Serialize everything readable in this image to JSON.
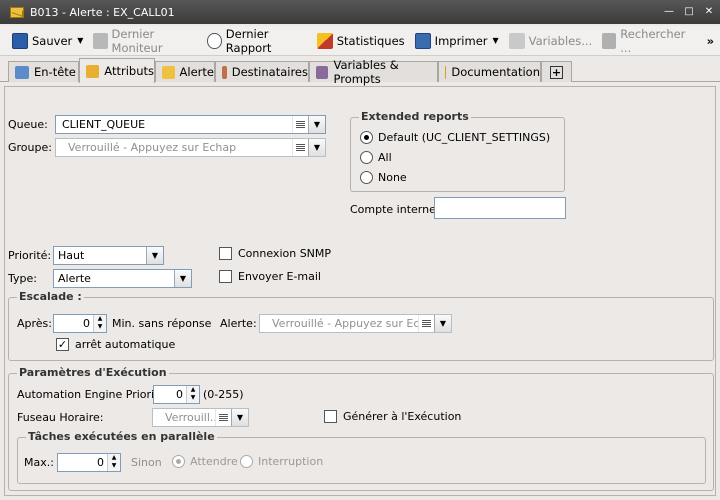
{
  "window": {
    "title": "B013 - Alerte : EX_CALL01"
  },
  "toolbar": {
    "save": "Sauver",
    "last_monitor": "Dernier Moniteur",
    "last_report": "Dernier Rapport",
    "statistics": "Statistiques",
    "print": "Imprimer",
    "variables": "Variables...",
    "search": "Rechercher ...",
    "more": "»"
  },
  "tabs": [
    "En-tête",
    "Attributs",
    "Alerte",
    "Destinataires",
    "Variables & Prompts",
    "Documentation",
    "+"
  ],
  "active_tab": "Attributs",
  "form": {
    "queue_label": "Queue:",
    "queue_value": "CLIENT_QUEUE",
    "groupe_label": "Groupe:",
    "groupe_placeholder": "Verrouillé - Appuyez sur Echap",
    "extended": {
      "title": "Extended reports",
      "options": [
        "Default (UC_CLIENT_SETTINGS)",
        "All",
        "None"
      ],
      "selected": "Default (UC_CLIENT_SETTINGS)"
    },
    "compte_label": "Compte interne:",
    "compte_value": "",
    "priorite_label": "Priorité:",
    "priorite_value": "Haut",
    "type_label": "Type:",
    "type_value": "Alerte",
    "snmp_label": "Connexion SNMP",
    "snmp_checked": false,
    "email_label": "Envoyer E-mail",
    "email_checked": false
  },
  "escalade": {
    "title": "Escalade :",
    "apres_label": "Après:",
    "apres_value": "0",
    "min_label": "Min. sans réponse",
    "alerte_label": "Alerte:",
    "alerte_placeholder": "Verrouillé - Appuyez sur Echap",
    "arret_label": "arrêt automatique",
    "arret_checked": true
  },
  "execution": {
    "title": "Paramètres d'Exécution",
    "ae_prio_label": "Automation Engine Priorité:",
    "ae_prio_value": "0",
    "ae_range": "(0-255)",
    "fuseau_label": "Fuseau Horaire:",
    "fuseau_placeholder": "Verrouill...",
    "generer_label": "Générer à l'Exécution",
    "generer_checked": false,
    "parallel": {
      "title": "Tâches exécutées en parallèle",
      "max_label": "Max.:",
      "max_value": "0",
      "sinon_label": "Sinon",
      "options": [
        "Attendre",
        "Interruption"
      ],
      "selected": "Attendre"
    }
  }
}
